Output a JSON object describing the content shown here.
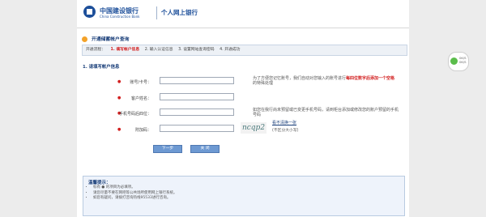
{
  "header": {
    "bank_cn": "中国建设银行",
    "bank_en": "China Construction Bank",
    "title": "个人网上银行"
  },
  "section_title": "开通储蓄帐户查询",
  "steps": {
    "prefix": "开通流程：",
    "items": [
      "1. 填写帐户信息",
      "2. 输入认证信息",
      "3. 设置网站查询密码",
      "4. 开通成功"
    ]
  },
  "form": {
    "title": "1. 请填写帐户信息",
    "rows": [
      {
        "label": "账号/卡号：",
        "value": "",
        "hint_prefix": "为了方便您记忆账号，我们自动对您输入的账号进行",
        "hint_red": "每四位数字后添加一个空格",
        "hint_suffix": "的特殊处理"
      },
      {
        "label": "客户姓名：",
        "value": ""
      },
      {
        "label": "手机号码后四位：",
        "value": "",
        "hint": "如您在我行尚未预留或已变更手机号码，请到柜台添加或修改您的账户预留的手机号码"
      },
      {
        "label": "附加码：",
        "value": ""
      }
    ],
    "captcha_text": "ncqp2",
    "captcha_link": "看不清换一张",
    "captcha_note": "(不区分大小写)"
  },
  "buttons": {
    "next": "下一步",
    "close": "关 闭"
  },
  "tips": {
    "title": "温馨提示：",
    "items": [
      "标有 ● 的项目为必填项。",
      "请您尽量不要在网吧等公共场所使用网上银行系统。",
      "如您有疑问，请拨打咨询热线95533进行咨询。"
    ]
  },
  "widget": {
    "line1": "0K/S",
    "line2": "0K/S"
  }
}
